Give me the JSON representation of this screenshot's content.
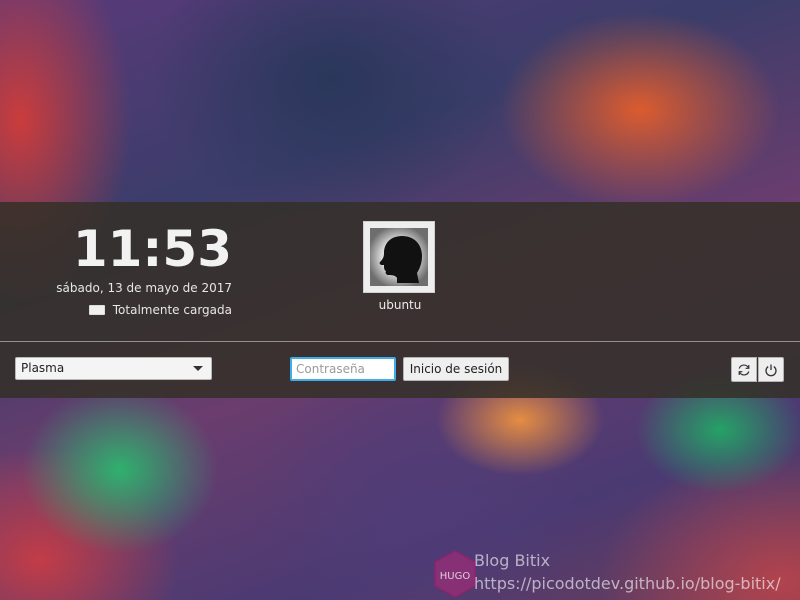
{
  "clock": {
    "time": "11:53",
    "date": "sábado, 13 de mayo de 2017"
  },
  "battery": {
    "icon": "battery-icon",
    "status": "Totalmente cargada"
  },
  "user": {
    "name": "ubuntu",
    "avatar_icon": "user-head-silhouette-icon"
  },
  "session": {
    "selected": "Plasma"
  },
  "login": {
    "password_placeholder": "Contraseña",
    "password_value": "",
    "login_label": "Inicio de sesión"
  },
  "power": {
    "restart_icon": "restart-icon",
    "shutdown_icon": "power-icon"
  },
  "watermark": {
    "logo_text": "HUGO",
    "title": "Blog Bitix",
    "url": "https://picodotdev.github.io/blog-bitix/"
  },
  "colors": {
    "accent": "#3daee9",
    "panel": "#34302a"
  }
}
